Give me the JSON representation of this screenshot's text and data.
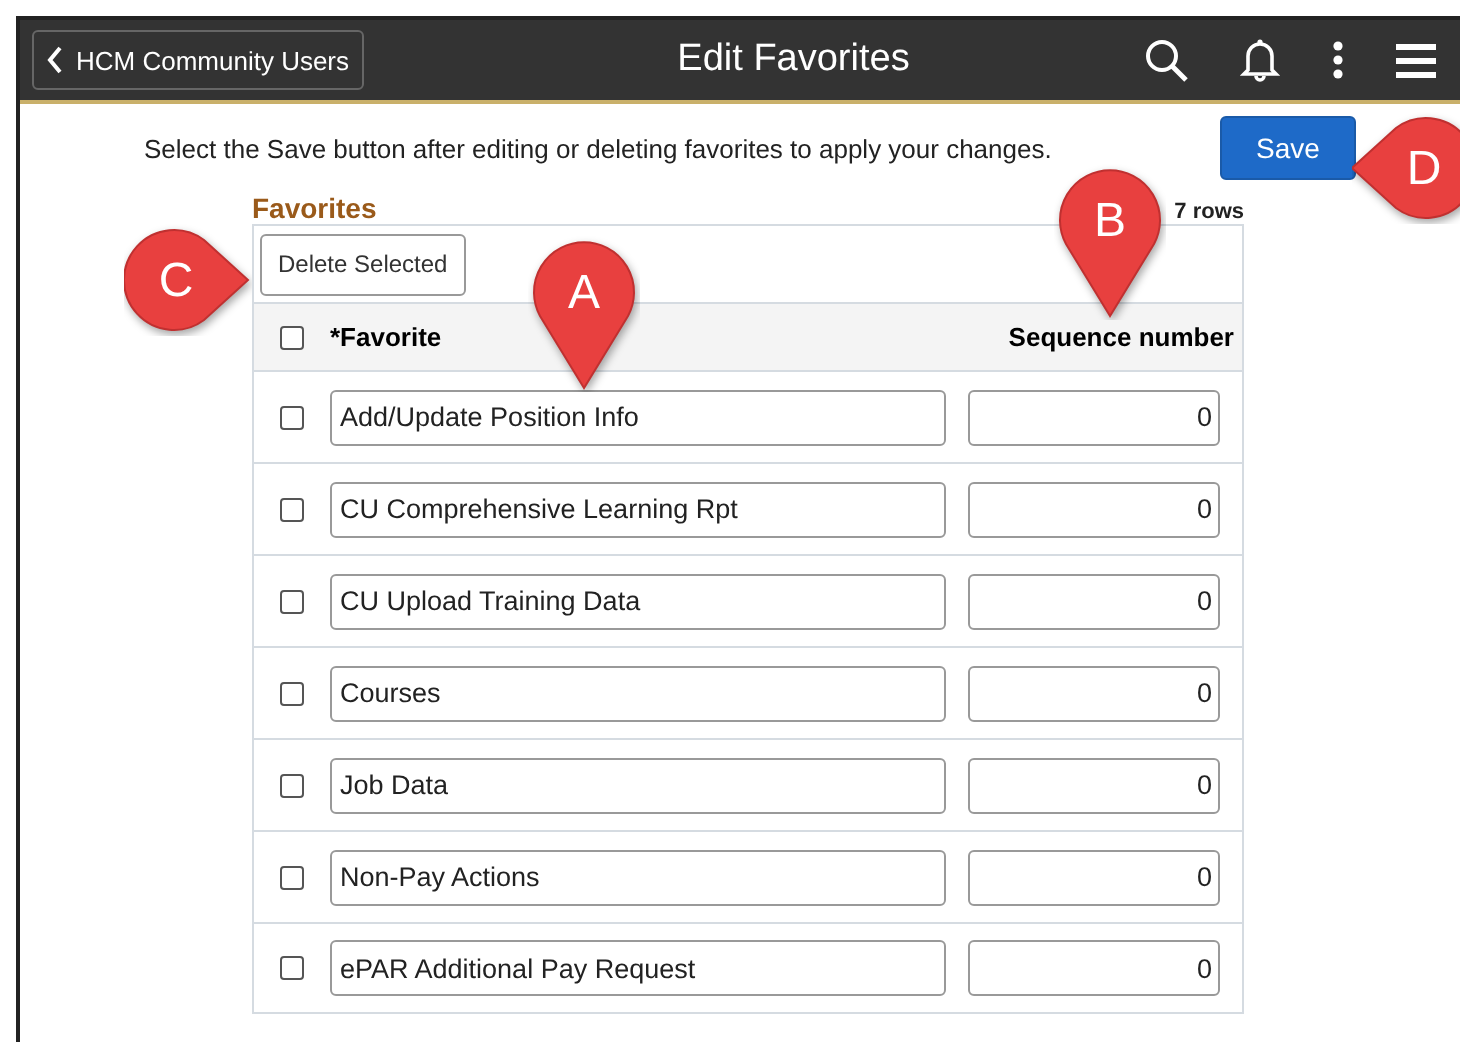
{
  "header": {
    "back_label": "HCM Community Users",
    "title": "Edit Favorites"
  },
  "instruction": "Select the Save button after editing or deleting favorites to apply your changes.",
  "save_button": "Save",
  "grid": {
    "title": "Favorites",
    "row_count": "7 rows",
    "delete_button": "Delete Selected",
    "select_all_checked": false,
    "columns": [
      "*Favorite",
      "Sequence number"
    ],
    "rows": [
      {
        "checked": false,
        "favorite": "Add/Update Position Info",
        "sequence": "0"
      },
      {
        "checked": false,
        "favorite": "CU Comprehensive Learning Rpt",
        "sequence": "0"
      },
      {
        "checked": false,
        "favorite": "CU Upload Training Data",
        "sequence": "0"
      },
      {
        "checked": false,
        "favorite": "Courses",
        "sequence": "0"
      },
      {
        "checked": false,
        "favorite": "Job Data",
        "sequence": "0"
      },
      {
        "checked": false,
        "favorite": "Non-Pay Actions",
        "sequence": "0"
      },
      {
        "checked": false,
        "favorite": "ePAR Additional Pay Request",
        "sequence": "0"
      }
    ]
  },
  "callouts": [
    {
      "label": "A",
      "kind": "down"
    },
    {
      "label": "B",
      "kind": "down"
    },
    {
      "label": "C",
      "kind": "right"
    },
    {
      "label": "D",
      "kind": "left"
    }
  ]
}
